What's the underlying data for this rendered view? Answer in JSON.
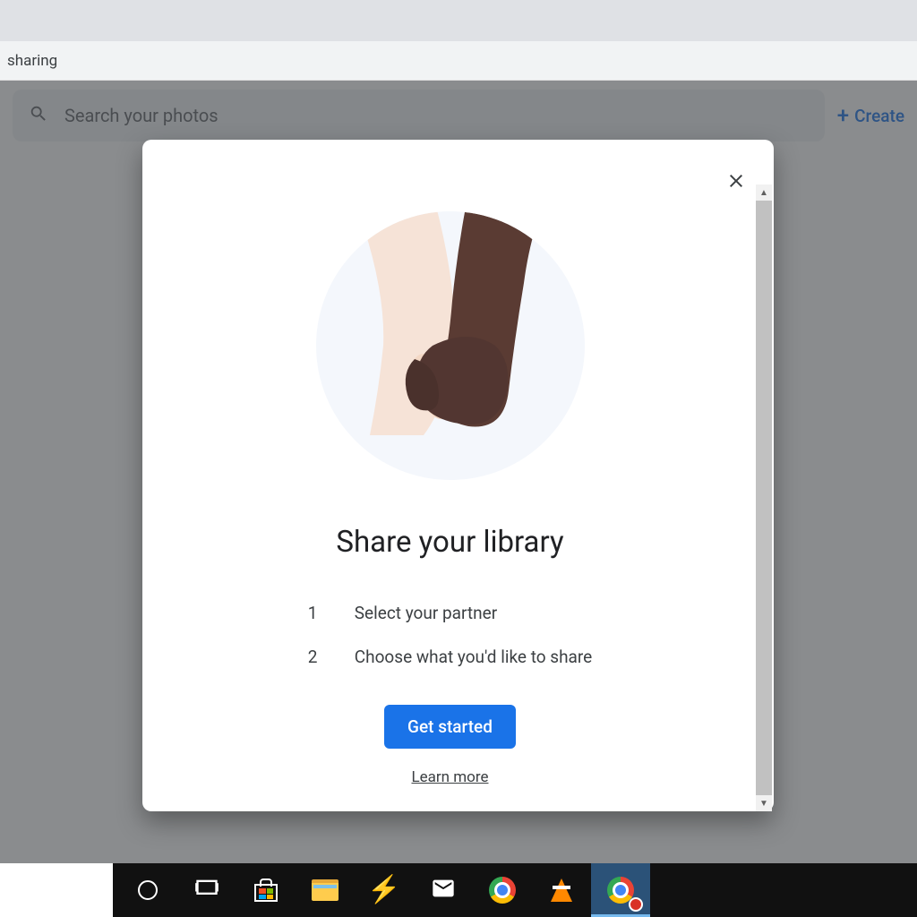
{
  "browser": {
    "url_fragment": "sharing"
  },
  "header": {
    "search_placeholder": "Search your photos",
    "create_label": "Create"
  },
  "modal": {
    "title": "Share your library",
    "steps": [
      {
        "num": "1",
        "text": "Select your partner"
      },
      {
        "num": "2",
        "text": "Choose what you'd like to share"
      }
    ],
    "primary_button": "Get started",
    "learn_more": "Learn more"
  }
}
